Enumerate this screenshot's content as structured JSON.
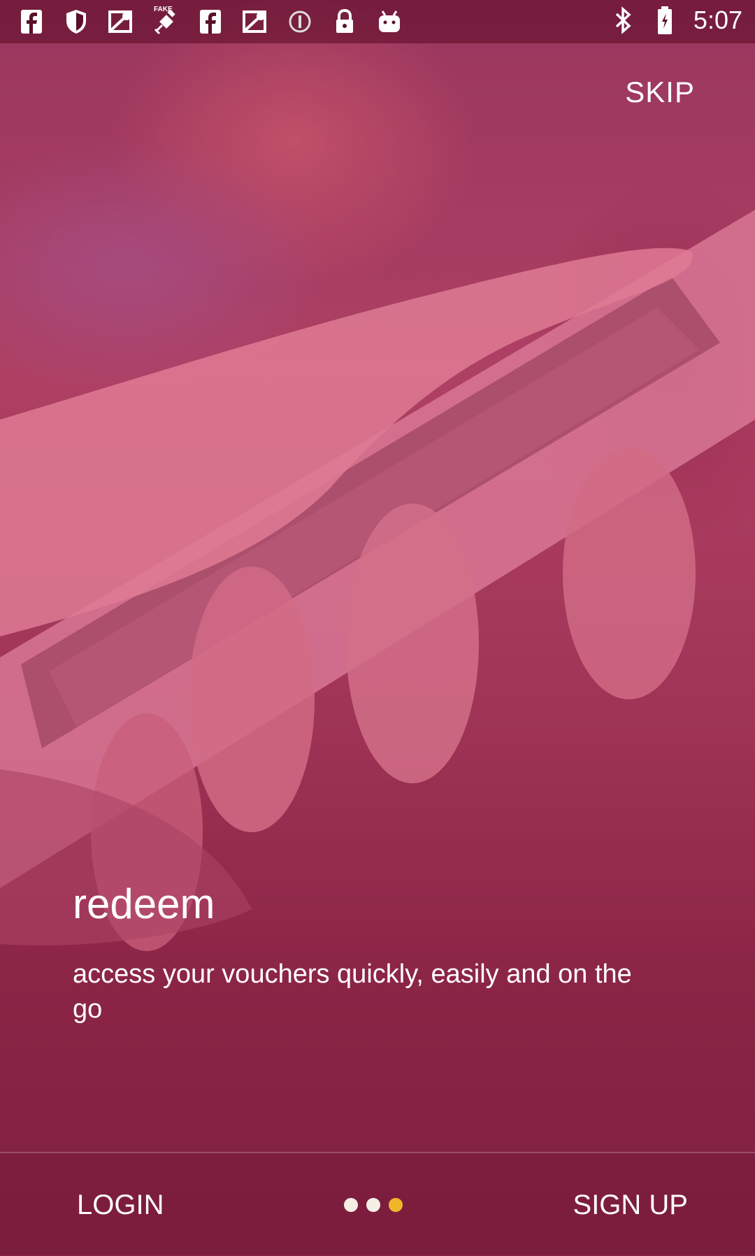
{
  "status_bar": {
    "left_icons": [
      "facebook-icon",
      "shield-icon",
      "maps-icon",
      "fake-gps-icon",
      "facebook-icon",
      "maps-icon",
      "info-icon",
      "lock-icon",
      "android-icon"
    ],
    "fake_label": "FAKE",
    "right_icons": [
      "bluetooth-icon",
      "battery-icon"
    ],
    "time": "5:07"
  },
  "header": {
    "skip_label": "SKIP"
  },
  "onboarding": {
    "title": "redeem",
    "description": "access your vouchers quickly, easily and on the go"
  },
  "bottom_bar": {
    "login_label": "LOGIN",
    "signup_label": "SIGN UP",
    "page_indicator": {
      "total": 3,
      "active_index": 2
    }
  },
  "colors": {
    "overlay": "#8e2748",
    "dot_inactive": "#f5f0e6",
    "dot_active": "#f0b62b",
    "text": "#ffffff"
  }
}
